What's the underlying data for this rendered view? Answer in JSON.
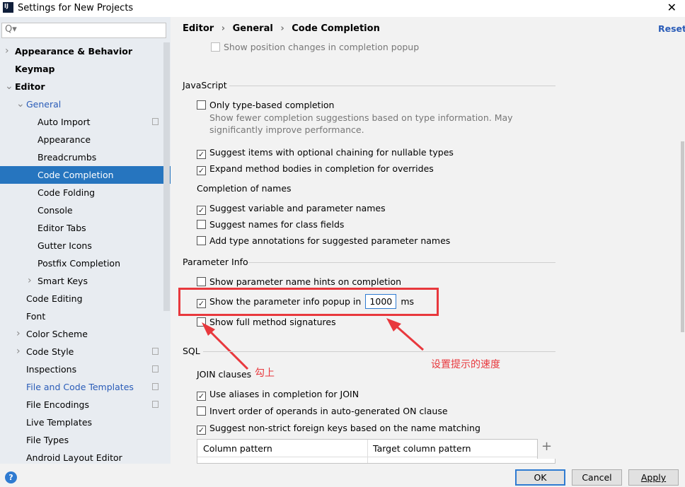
{
  "window": {
    "title": "Settings for New Projects",
    "logo": "IJ",
    "close": "✕"
  },
  "search": {
    "placeholder": "Q▾"
  },
  "sidebar": {
    "items": [
      {
        "label": "Appearance & Behavior",
        "level": 0,
        "chevron": "right",
        "bold": true
      },
      {
        "label": "Keymap",
        "level": 0,
        "bold": true
      },
      {
        "label": "Editor",
        "level": 0,
        "chevron": "down",
        "bold": true
      },
      {
        "label": "General",
        "level": 1,
        "chevron": "down",
        "link": true
      },
      {
        "label": "Auto Import",
        "level": 2,
        "copy": true
      },
      {
        "label": "Appearance",
        "level": 2
      },
      {
        "label": "Breadcrumbs",
        "level": 2
      },
      {
        "label": "Code Completion",
        "level": 2,
        "selected": true
      },
      {
        "label": "Code Folding",
        "level": 2
      },
      {
        "label": "Console",
        "level": 2
      },
      {
        "label": "Editor Tabs",
        "level": 2
      },
      {
        "label": "Gutter Icons",
        "level": 2
      },
      {
        "label": "Postfix Completion",
        "level": 2
      },
      {
        "label": "Smart Keys",
        "level": 2,
        "chevron": "right"
      },
      {
        "label": "Code Editing",
        "level": 1
      },
      {
        "label": "Font",
        "level": 1
      },
      {
        "label": "Color Scheme",
        "level": 1,
        "chevron": "right"
      },
      {
        "label": "Code Style",
        "level": 1,
        "chevron": "right",
        "copy": true
      },
      {
        "label": "Inspections",
        "level": 1,
        "copy": true
      },
      {
        "label": "File and Code Templates",
        "level": 1,
        "copy": true,
        "link": true
      },
      {
        "label": "File Encodings",
        "level": 1,
        "copy": true
      },
      {
        "label": "Live Templates",
        "level": 1
      },
      {
        "label": "File Types",
        "level": 1
      },
      {
        "label": "Android Layout Editor",
        "level": 1
      }
    ]
  },
  "breadcrumb": {
    "a": "Editor",
    "b": "General",
    "c": "Code Completion",
    "sep": "›"
  },
  "reset": "Reset",
  "content": {
    "top_disabled": "Show position changes in completion popup",
    "javascript": {
      "title": "JavaScript",
      "only_type": "Only type-based completion",
      "only_type_desc1": "Show fewer completion suggestions based on type information. May",
      "only_type_desc2": "significantly improve performance.",
      "optional_chaining": "Suggest items with optional chaining for nullable types",
      "expand_bodies": "Expand method bodies in completion for overrides",
      "names_title": "Completion of names",
      "suggest_var": "Suggest variable and parameter names",
      "suggest_class_fields": "Suggest names for class fields",
      "add_type_ann": "Add type annotations for suggested parameter names"
    },
    "param_info": {
      "title": "Parameter Info",
      "name_hints": "Show parameter name hints on completion",
      "popup_in": "Show the parameter info popup in",
      "popup_ms": "1000",
      "ms": "ms",
      "full_sig": "Show full method signatures"
    },
    "sql": {
      "title": "SQL",
      "join": "JOIN clauses",
      "aliases": "Use aliases in completion for JOIN",
      "invert": "Invert order of operands in auto-generated ON clause",
      "non_strict": "Suggest non-strict foreign keys based on the name matching",
      "table": {
        "col1": "Column pattern",
        "col2": "Target column pattern",
        "add": "+"
      }
    }
  },
  "annotations": {
    "check": "勾上",
    "speed": "设置提示的速度",
    "color": "#e8383d"
  },
  "buttons": {
    "ok": "OK",
    "cancel": "Cancel",
    "apply": "Apply",
    "help": "?"
  }
}
